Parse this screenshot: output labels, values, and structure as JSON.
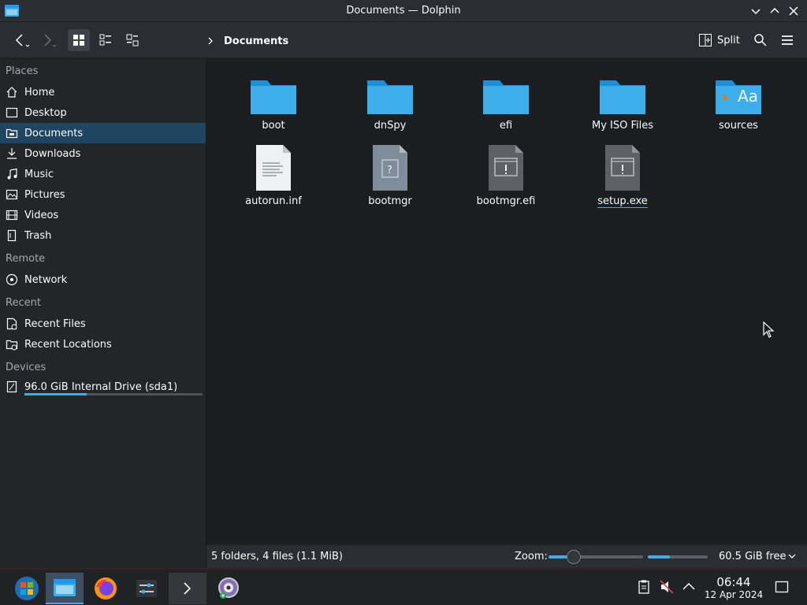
{
  "window": {
    "title": "Documents — Dolphin"
  },
  "toolbar": {
    "breadcrumb": "Documents",
    "split_label": "Split"
  },
  "sidebar": {
    "places_title": "Places",
    "places": [
      {
        "label": "Home",
        "icon": "home-icon"
      },
      {
        "label": "Desktop",
        "icon": "desktop-icon"
      },
      {
        "label": "Documents",
        "icon": "documents-icon",
        "selected": true
      },
      {
        "label": "Downloads",
        "icon": "download-icon"
      },
      {
        "label": "Music",
        "icon": "music-icon"
      },
      {
        "label": "Pictures",
        "icon": "pictures-icon"
      },
      {
        "label": "Videos",
        "icon": "videos-icon"
      },
      {
        "label": "Trash",
        "icon": "trash-icon"
      }
    ],
    "remote_title": "Remote",
    "remote": [
      {
        "label": "Network",
        "icon": "network-icon"
      }
    ],
    "recent_title": "Recent",
    "recent": [
      {
        "label": "Recent Files",
        "icon": "recent-files-icon"
      },
      {
        "label": "Recent Locations",
        "icon": "recent-locations-icon"
      }
    ],
    "devices_title": "Devices",
    "devices": [
      {
        "label": "96.0 GiB Internal Drive (sda1)",
        "icon": "drive-icon",
        "usage_fraction": 0.35
      }
    ]
  },
  "files": [
    {
      "name": "boot",
      "type": "folder"
    },
    {
      "name": "dnSpy",
      "type": "folder"
    },
    {
      "name": "efi",
      "type": "folder"
    },
    {
      "name": "My ISO Files",
      "type": "folder"
    },
    {
      "name": "sources",
      "type": "folder-fonts"
    },
    {
      "name": "autorun.inf",
      "type": "text"
    },
    {
      "name": "bootmgr",
      "type": "unknown"
    },
    {
      "name": "bootmgr.efi",
      "type": "executable"
    },
    {
      "name": "setup.exe",
      "type": "executable",
      "hovered": true
    }
  ],
  "statusbar": {
    "info": "5 folders, 4 files (1.1 MiB)",
    "zoom_label": "Zoom:",
    "zoom_fraction": 0.27,
    "disk_used_fraction": 0.37,
    "free_space": "60.5 GiB free"
  },
  "taskbar": {
    "time": "06:44",
    "date": "12 Apr 2024"
  },
  "colors": {
    "accent": "#3daee9",
    "folder": "#3daee9",
    "selection": "#1f4560"
  }
}
